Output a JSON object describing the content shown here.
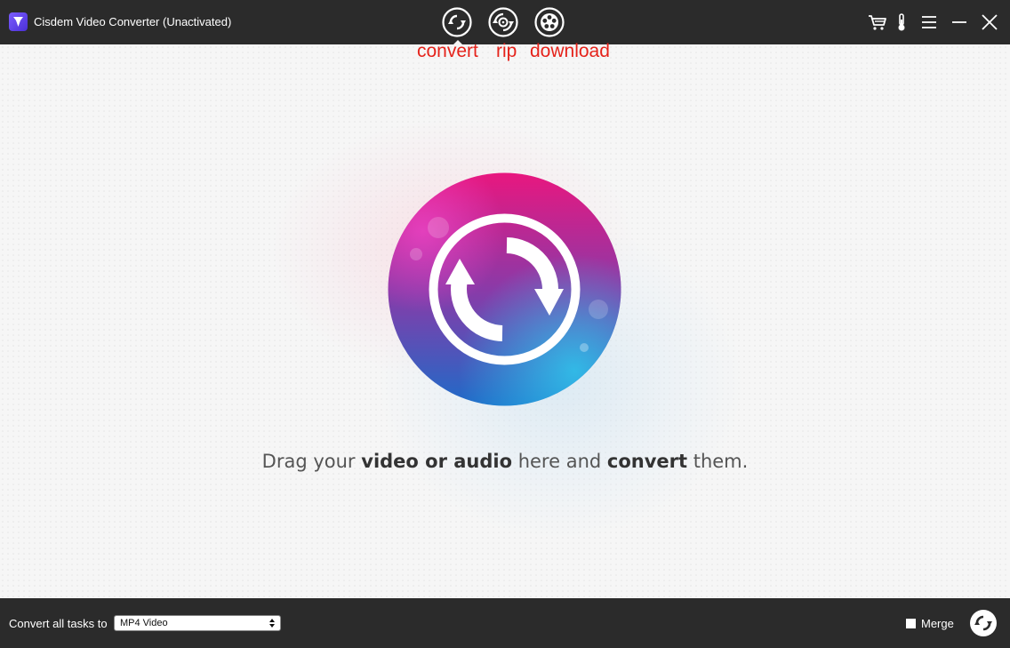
{
  "window": {
    "title": "Cisdem Video Converter (Unactivated)",
    "logo_icon": "cisdem-logo-icon"
  },
  "toolbar": {
    "modes": [
      {
        "icon": "convert-icon",
        "label": "convert",
        "selected": true
      },
      {
        "icon": "rip-icon",
        "label": "rip",
        "selected": false
      },
      {
        "icon": "download-icon",
        "label": "download",
        "selected": false
      }
    ],
    "right_icons": [
      "cart-icon",
      "thermometer-icon",
      "menu-icon",
      "minimize-icon",
      "close-icon"
    ]
  },
  "main": {
    "drop_icon": "convert-arrows-icon",
    "hint": {
      "part1": "Drag your ",
      "bold1": "video or audio",
      "part2": " here and ",
      "bold2": "convert",
      "part3": " them."
    }
  },
  "bottom": {
    "convert_label": "Convert all tasks to",
    "format_value": "MP4 Video",
    "merge_label": "Merge",
    "merge_checked": false,
    "convert_button_icon": "convert-all-icon"
  },
  "colors": {
    "bar_bg": "#2b2b2b",
    "annotation_red": "#e5231b",
    "gradient_pink": "#e8177f",
    "gradient_blue": "#1e6bc8"
  }
}
